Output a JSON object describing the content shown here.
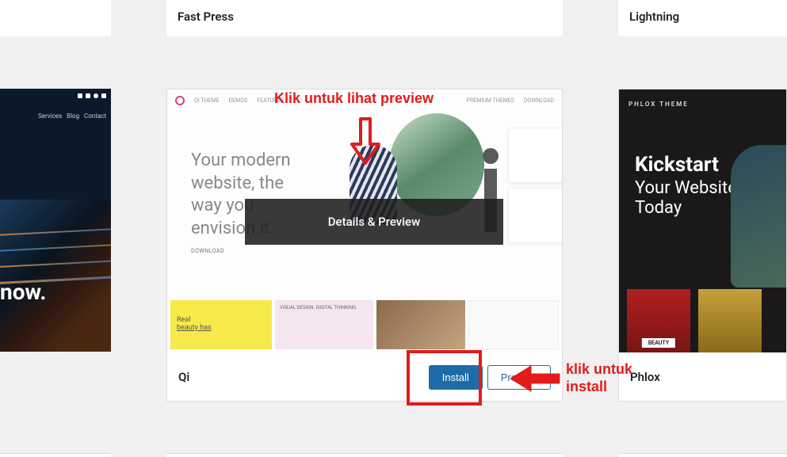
{
  "annotations": {
    "preview_text": "Klik untuk lihat preview",
    "install_text_line1": "klik untuk",
    "install_text_line2": "install"
  },
  "top_row": {
    "center_name": "Fast Press",
    "right_name": "Lightning"
  },
  "main_theme": {
    "name": "Qi",
    "overlay_label": "Details & Preview",
    "install_label": "Install",
    "preview_label": "Preview",
    "thumb": {
      "nav": [
        "QI THEME",
        "DEMOS",
        "FEATURES"
      ],
      "nav_right": [
        "PREMIUM THEMES",
        "DOWNLOAD"
      ],
      "hero_line1": "Your modern",
      "hero_line2": "website, the",
      "hero_line3": "way you",
      "hero_line4": "envision it.",
      "download": "DOWNLOAD",
      "tile_yellow_line1": "Real",
      "tile_yellow_line2": "beauty has",
      "tile_text": "VISUAL DESIGN. DIGITAL THINKING."
    }
  },
  "right_theme": {
    "name": "Phlox",
    "brand": "PHLOX THEME",
    "hero_line1": "Kickstart",
    "hero_line2": "Your Website",
    "hero_line3": "Today",
    "badge1": "BEAUTY",
    "badge2": ""
  },
  "left_theme": {
    "nav": [
      "Services",
      "Blog",
      "Contact"
    ],
    "hero": "now."
  }
}
